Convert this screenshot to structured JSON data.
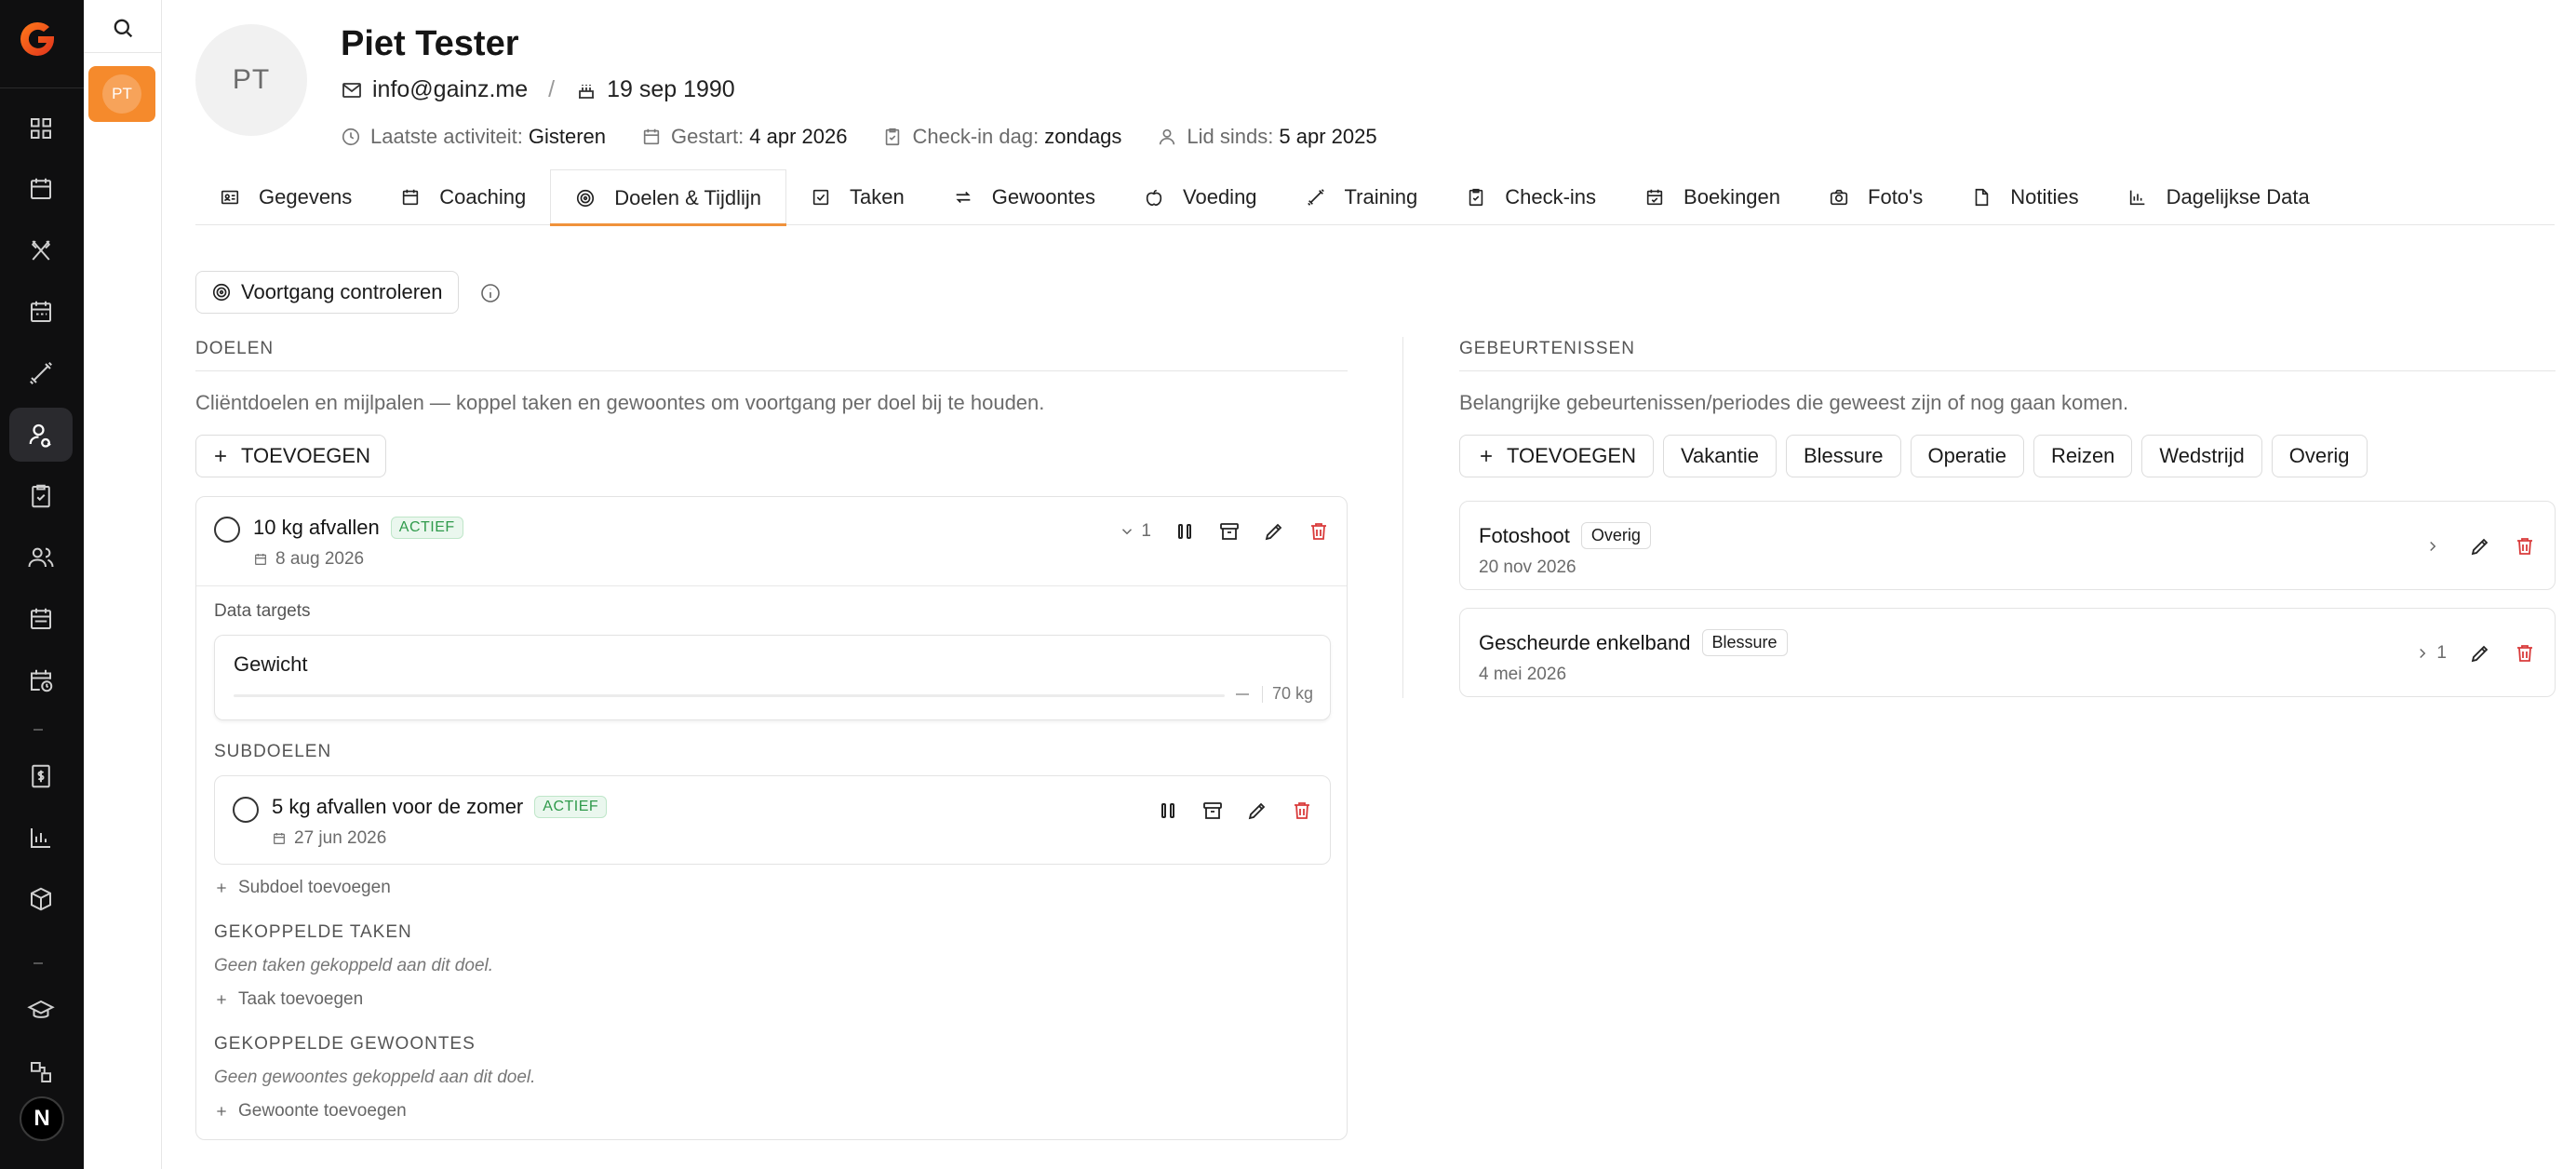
{
  "profile": {
    "initials": "PT",
    "name": "Piet Tester",
    "email": "info@gainz.me",
    "separator": "/",
    "birthdate": "19 sep 1990",
    "last_activity_label": "Laatste activiteit:",
    "last_activity": "Gisteren",
    "started_label": "Gestart:",
    "started": "4 apr 2026",
    "checkin_label": "Check-in dag:",
    "checkin": "zondags",
    "member_label": "Lid sinds:",
    "member": "5 apr 2025"
  },
  "sidebar": {
    "client_initials": "PT",
    "user_initial": "N"
  },
  "tabs": [
    {
      "label": "Gegevens",
      "icon": "id-card-icon"
    },
    {
      "label": "Coaching",
      "icon": "calendar-icon"
    },
    {
      "label": "Doelen & Tijdlijn",
      "icon": "target-icon",
      "active": true
    },
    {
      "label": "Taken",
      "icon": "check-square-icon"
    },
    {
      "label": "Gewoontes",
      "icon": "repeat-icon"
    },
    {
      "label": "Voeding",
      "icon": "apple-icon"
    },
    {
      "label": "Training",
      "icon": "dumbbell-icon"
    },
    {
      "label": "Check-ins",
      "icon": "clipboard-check-icon"
    },
    {
      "label": "Boekingen",
      "icon": "calendar-check-icon"
    },
    {
      "label": "Foto's",
      "icon": "camera-icon"
    },
    {
      "label": "Notities",
      "icon": "file-icon"
    },
    {
      "label": "Dagelijkse Data",
      "icon": "bar-chart-icon"
    }
  ],
  "progress_button": "Voortgang controleren",
  "goals": {
    "title": "DOELEN",
    "description": "Cliëntdoelen en mijlpalen — koppel taken en gewoontes om voortgang per doel bij te houden.",
    "add_label": "TOEVOEGEN",
    "goal": {
      "title": "10 kg afvallen",
      "status": "ACTIEF",
      "date": "8 aug 2026",
      "sub_count": "1",
      "data_targets_label": "Data targets",
      "target_name": "Gewicht",
      "target_value": "70 kg",
      "subgoals_label": "SUBDOELEN",
      "subgoal": {
        "title": "5 kg afvallen voor de zomer",
        "status": "ACTIEF",
        "date": "27 jun 2026"
      },
      "add_subgoal": "Subdoel toevoegen",
      "linked_tasks_label": "GEKOPPELDE TAKEN",
      "no_tasks": "Geen taken gekoppeld aan dit doel.",
      "add_task": "Taak toevoegen",
      "linked_habits_label": "GEKOPPELDE GEWOONTES",
      "no_habits": "Geen gewoontes gekoppeld aan dit doel.",
      "add_habit": "Gewoonte toevoegen"
    }
  },
  "events": {
    "title": "GEBEURTENISSEN",
    "description": "Belangrijke gebeurtenissen/periodes die geweest zijn of nog gaan komen.",
    "add_label": "TOEVOEGEN",
    "categories": [
      "Vakantie",
      "Blessure",
      "Operatie",
      "Reizen",
      "Wedstrijd",
      "Overig"
    ],
    "items": [
      {
        "title": "Fotoshoot",
        "tag": "Overig",
        "date": "20 nov 2026",
        "count": ""
      },
      {
        "title": "Gescheurde enkelband",
        "tag": "Blessure",
        "date": "4 mei 2026",
        "count": "1"
      }
    ]
  },
  "colors": {
    "accent": "#f0923b",
    "active_badge": "#2f9a4b",
    "delete": "#d93b3b",
    "rail_bg": "#0f0f10"
  }
}
